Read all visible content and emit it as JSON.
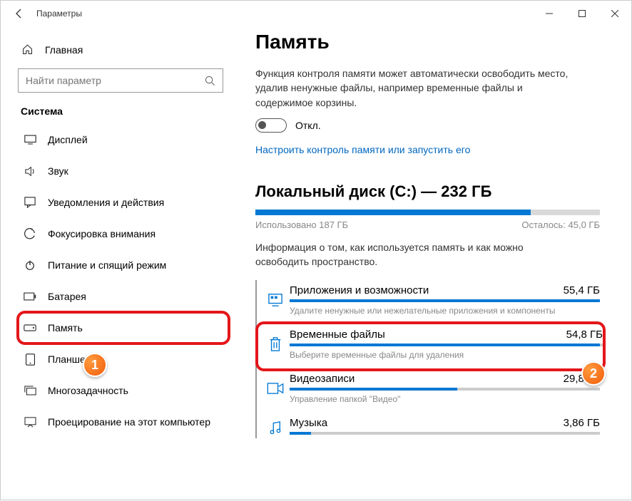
{
  "window": {
    "title": "Параметры"
  },
  "sidebar": {
    "home": "Главная",
    "search_placeholder": "Найти параметр",
    "section": "Система",
    "items": [
      {
        "label": "Дисплей"
      },
      {
        "label": "Звук"
      },
      {
        "label": "Уведомления и действия"
      },
      {
        "label": "Фокусировка внимания"
      },
      {
        "label": "Питание и спящий режим"
      },
      {
        "label": "Батарея"
      },
      {
        "label": "Память",
        "highlight": true
      },
      {
        "label": "Планшет"
      },
      {
        "label": "Многозадачность"
      },
      {
        "label": "Проецирование на этот компьютер"
      }
    ]
  },
  "callouts": {
    "one": "1",
    "two": "2"
  },
  "main": {
    "title": "Память",
    "desc": "Функция контроля памяти может автоматически освободить место, удалив ненужные файлы, например временные файлы и содержимое корзины.",
    "toggle_label": "Откл.",
    "link": "Настроить контроль памяти или запустить его",
    "disk_heading": "Локальный диск (C:) — 232 ГБ",
    "usage": {
      "used_label": "Использовано 187 ГБ",
      "free_label": "Осталось: 45,0 ГБ",
      "fill_percent": 80
    },
    "info": "Информация о том, как используется память и как можно освободить пространство.",
    "categories": [
      {
        "name": "Приложения и возможности",
        "size": "55,4 ГБ",
        "desc": "Удалите ненужные или нежелательные приложения и компоненты",
        "fill": 100
      },
      {
        "name": "Временные файлы",
        "size": "54,8 ГБ",
        "desc": "Выберите временные файлы для удаления",
        "fill": 99,
        "highlight": true
      },
      {
        "name": "Видеозаписи",
        "size": "29,8 ГБ",
        "desc": "Управление папкой \"Видео\"",
        "fill": 54
      },
      {
        "name": "Музыка",
        "size": "3,86 ГБ",
        "desc": "",
        "fill": 7
      }
    ]
  }
}
